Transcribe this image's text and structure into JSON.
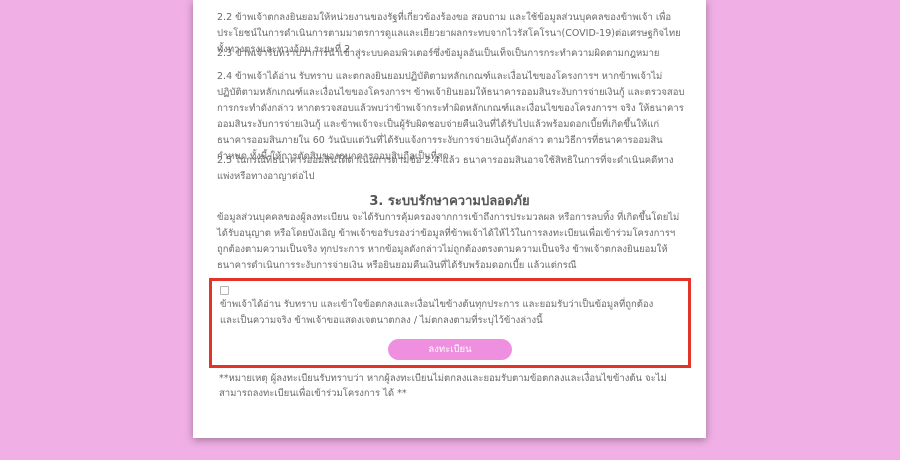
{
  "paragraphs": {
    "p2_2": "2.2 ข้าพเจ้าตกลงยินยอมให้หน่วยงานของรัฐที่เกี่ยวข้องร้องขอ สอบถาม และใช้ข้อมูลส่วนบุคคลของข้าพเจ้า เพื่อประโยชน์ในการดำเนินการตามมาตรการดูแลและเยียวยาผลกระทบจากไวรัสโคโรนา(COVID-19)ต่อเศรษฐกิจไทยทั้งทางตรงและทางอ้อม ระยะที่ 2",
    "p2_3": "2.3 ข้าพเจ้ารับทราบว่าการนำเข้าสู่ระบบคอมพิวเตอร์ซึ่งข้อมูลอันเป็นเท็จเป็นการกระทำความผิดตามกฎหมาย",
    "p2_4": "2.4 ข้าพเจ้าได้อ่าน รับทราบ และตกลงยินยอมปฏิบัติตามหลักเกณฑ์และเงื่อนไขของโครงการฯ หากข้าพเจ้าไม่ปฏิบัติตามหลักเกณฑ์และเงื่อนไขของโครงการฯ ข้าพเจ้ายินยอมให้ธนาคารออมสินระงับการจ่ายเงินกู้ และตรวจสอบการกระทำดังกล่าว หากตรวจสอบแล้วพบว่าข้าพเจ้ากระทำผิดหลักเกณฑ์และเงื่อนไขของโครงการฯ จริง ให้ธนาคารออมสินระงับการจ่ายเงินกู้ และข้าพเจ้าจะเป็นผู้รับผิดชอบจ่ายคืนเงินที่ได้รับไปแล้วพร้อมดอกเบี้ยที่เกิดขึ้นให้แก่ธนาคารออมสินภายใน 60 วันนับแต่วันที่ได้รับแจ้งการระงับการจ่ายเงินกู้ดังกล่าว ตามวิธีการที่ธนาคารออมสินกำหนด ทั้งนี้ ให้การตัดสินของธนาคารออมสินถือเป็นที่สุด",
    "p2_5": "2.5 ในกรณีที่ธนาคารออมสินได้ดำเนินการตามข้อ 2.4 แล้ว ธนาคารออมสินอาจใช้สิทธิในการที่จะดำเนินคดีทางแพ่งหรือทางอาญาต่อไป"
  },
  "section3": {
    "title": "3. ระบบรักษาความปลอดภัย",
    "body": "ข้อมูลส่วนบุคคลของผู้ลงทะเบียน จะได้รับการคุ้มครองจากการเข้าถึงการประมวลผล หรือการลบทิ้ง ที่เกิดขึ้นโดยไม่ได้รับอนุญาต หรือโดยบังเอิญ ข้าพเจ้าขอรับรองว่าข้อมูลที่ข้าพเจ้าได้ให้ไว้ในการลงทะเบียนเพื่อเข้าร่วมโครงการฯ ถูกต้องตามความเป็นจริง ทุกประการ หากข้อมูลดังกล่าวไม่ถูกต้องตรงตามความเป็นจริง ข้าพเจ้าตกลงยินยอมให้ธนาคารดำเนินการระงับการจ่ายเงิน หรือยินยอมคืนเงินที่ได้รับพร้อมดอกเบี้ย แล้วแต่กรณี"
  },
  "consent": {
    "text": "ข้าพเจ้าได้อ่าน รับทราบ และเข้าใจข้อตกลงและเงื่อนไขข้างต้นทุกประการ และยอมรับว่าเป็นข้อมูลที่ถูกต้อง และเป็นความจริง ข้าพเจ้าขอแสดงเจตนาตกลง / ไม่ตกลงตามที่ระบุไว้ข้างล่างนี้",
    "button_label": "ลงทะเบียน"
  },
  "note": "**หมายเหตุ ผู้ลงทะเบียนรับทราบว่า หากผู้ลงทะเบียนไม่ตกลงและยอมรับตามข้อตกลงและเงื่อนไขข้างต้น จะไม่สามารถลงทะเบียนเพื่อเข้าร่วมโครงการ ได้ **",
  "colors": {
    "page_background": "#f0b0e6",
    "button": "#ee8fe0",
    "highlight_border": "#e3342a"
  }
}
